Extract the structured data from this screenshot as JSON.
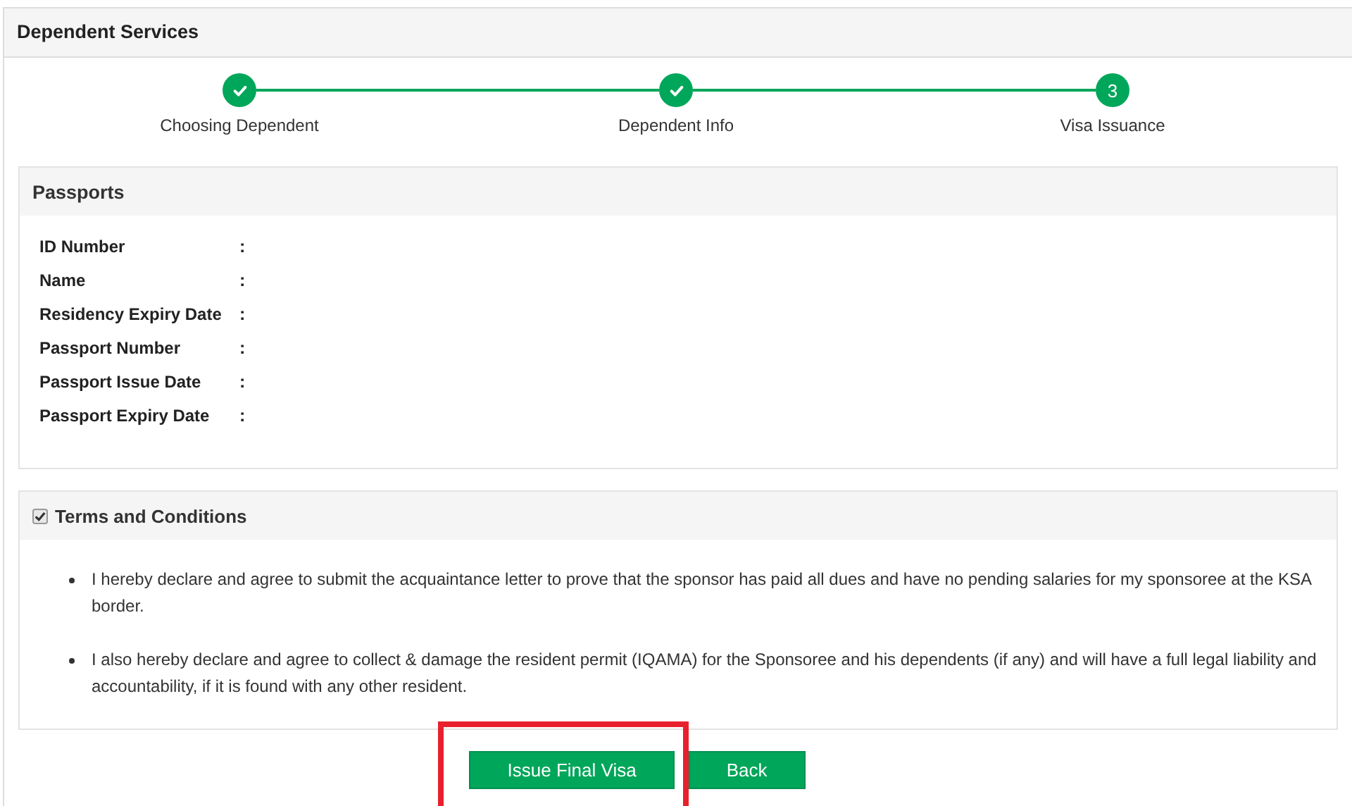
{
  "panel": {
    "title": "Dependent Services"
  },
  "steps": [
    {
      "label": "Choosing Dependent",
      "completed": true
    },
    {
      "label": "Dependent Info",
      "completed": true
    },
    {
      "label": "Visa Issuance",
      "completed": false,
      "number": "3"
    }
  ],
  "passports": {
    "title": "Passports",
    "fields": [
      {
        "label": "ID Number",
        "separator": ":"
      },
      {
        "label": "Name",
        "separator": ":"
      },
      {
        "label": "Residency Expiry Date",
        "separator": ":"
      },
      {
        "label": "Passport Number",
        "separator": ":"
      },
      {
        "label": "Passport Issue Date",
        "separator": ":"
      },
      {
        "label": "Passport Expiry Date",
        "separator": ":"
      }
    ]
  },
  "terms": {
    "title": "Terms and Conditions",
    "checked": true,
    "items": [
      "I hereby declare and agree to submit the acquaintance letter to prove that the sponsor has paid all dues and have no pending salaries for my sponsoree at the KSA border.",
      "I also hereby declare and agree to collect & damage the resident permit (IQAMA) for the Sponsoree and his dependents (if any) and will have a full legal liability and accountability, if it is found with any other resident."
    ]
  },
  "buttons": [
    {
      "label": "Issue Final Visa",
      "highlighted": true
    },
    {
      "label": "Back",
      "highlighted": false
    }
  ]
}
